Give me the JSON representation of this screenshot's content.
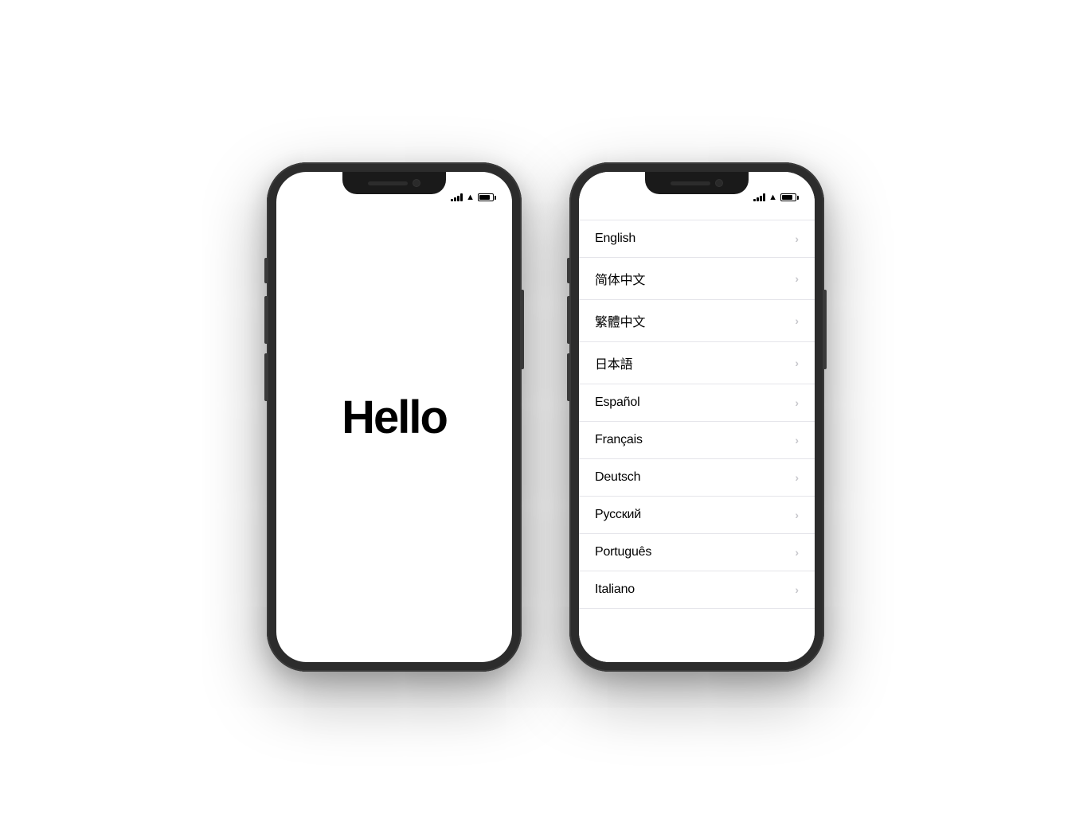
{
  "page": {
    "background": "#ffffff"
  },
  "phone_left": {
    "status_bar": {
      "signal_label": "signal",
      "wifi_label": "wifi",
      "battery_label": "battery"
    },
    "screen": {
      "hello_text": "Hello"
    }
  },
  "phone_right": {
    "status_bar": {
      "signal_label": "signal",
      "wifi_label": "wifi",
      "battery_label": "battery"
    },
    "languages": [
      {
        "name": "English"
      },
      {
        "name": "简体中文"
      },
      {
        "name": "繁體中文"
      },
      {
        "name": "日本語"
      },
      {
        "name": "Español"
      },
      {
        "name": "Français"
      },
      {
        "name": "Deutsch"
      },
      {
        "name": "Русский"
      },
      {
        "name": "Português"
      },
      {
        "name": "Italiano"
      }
    ]
  }
}
